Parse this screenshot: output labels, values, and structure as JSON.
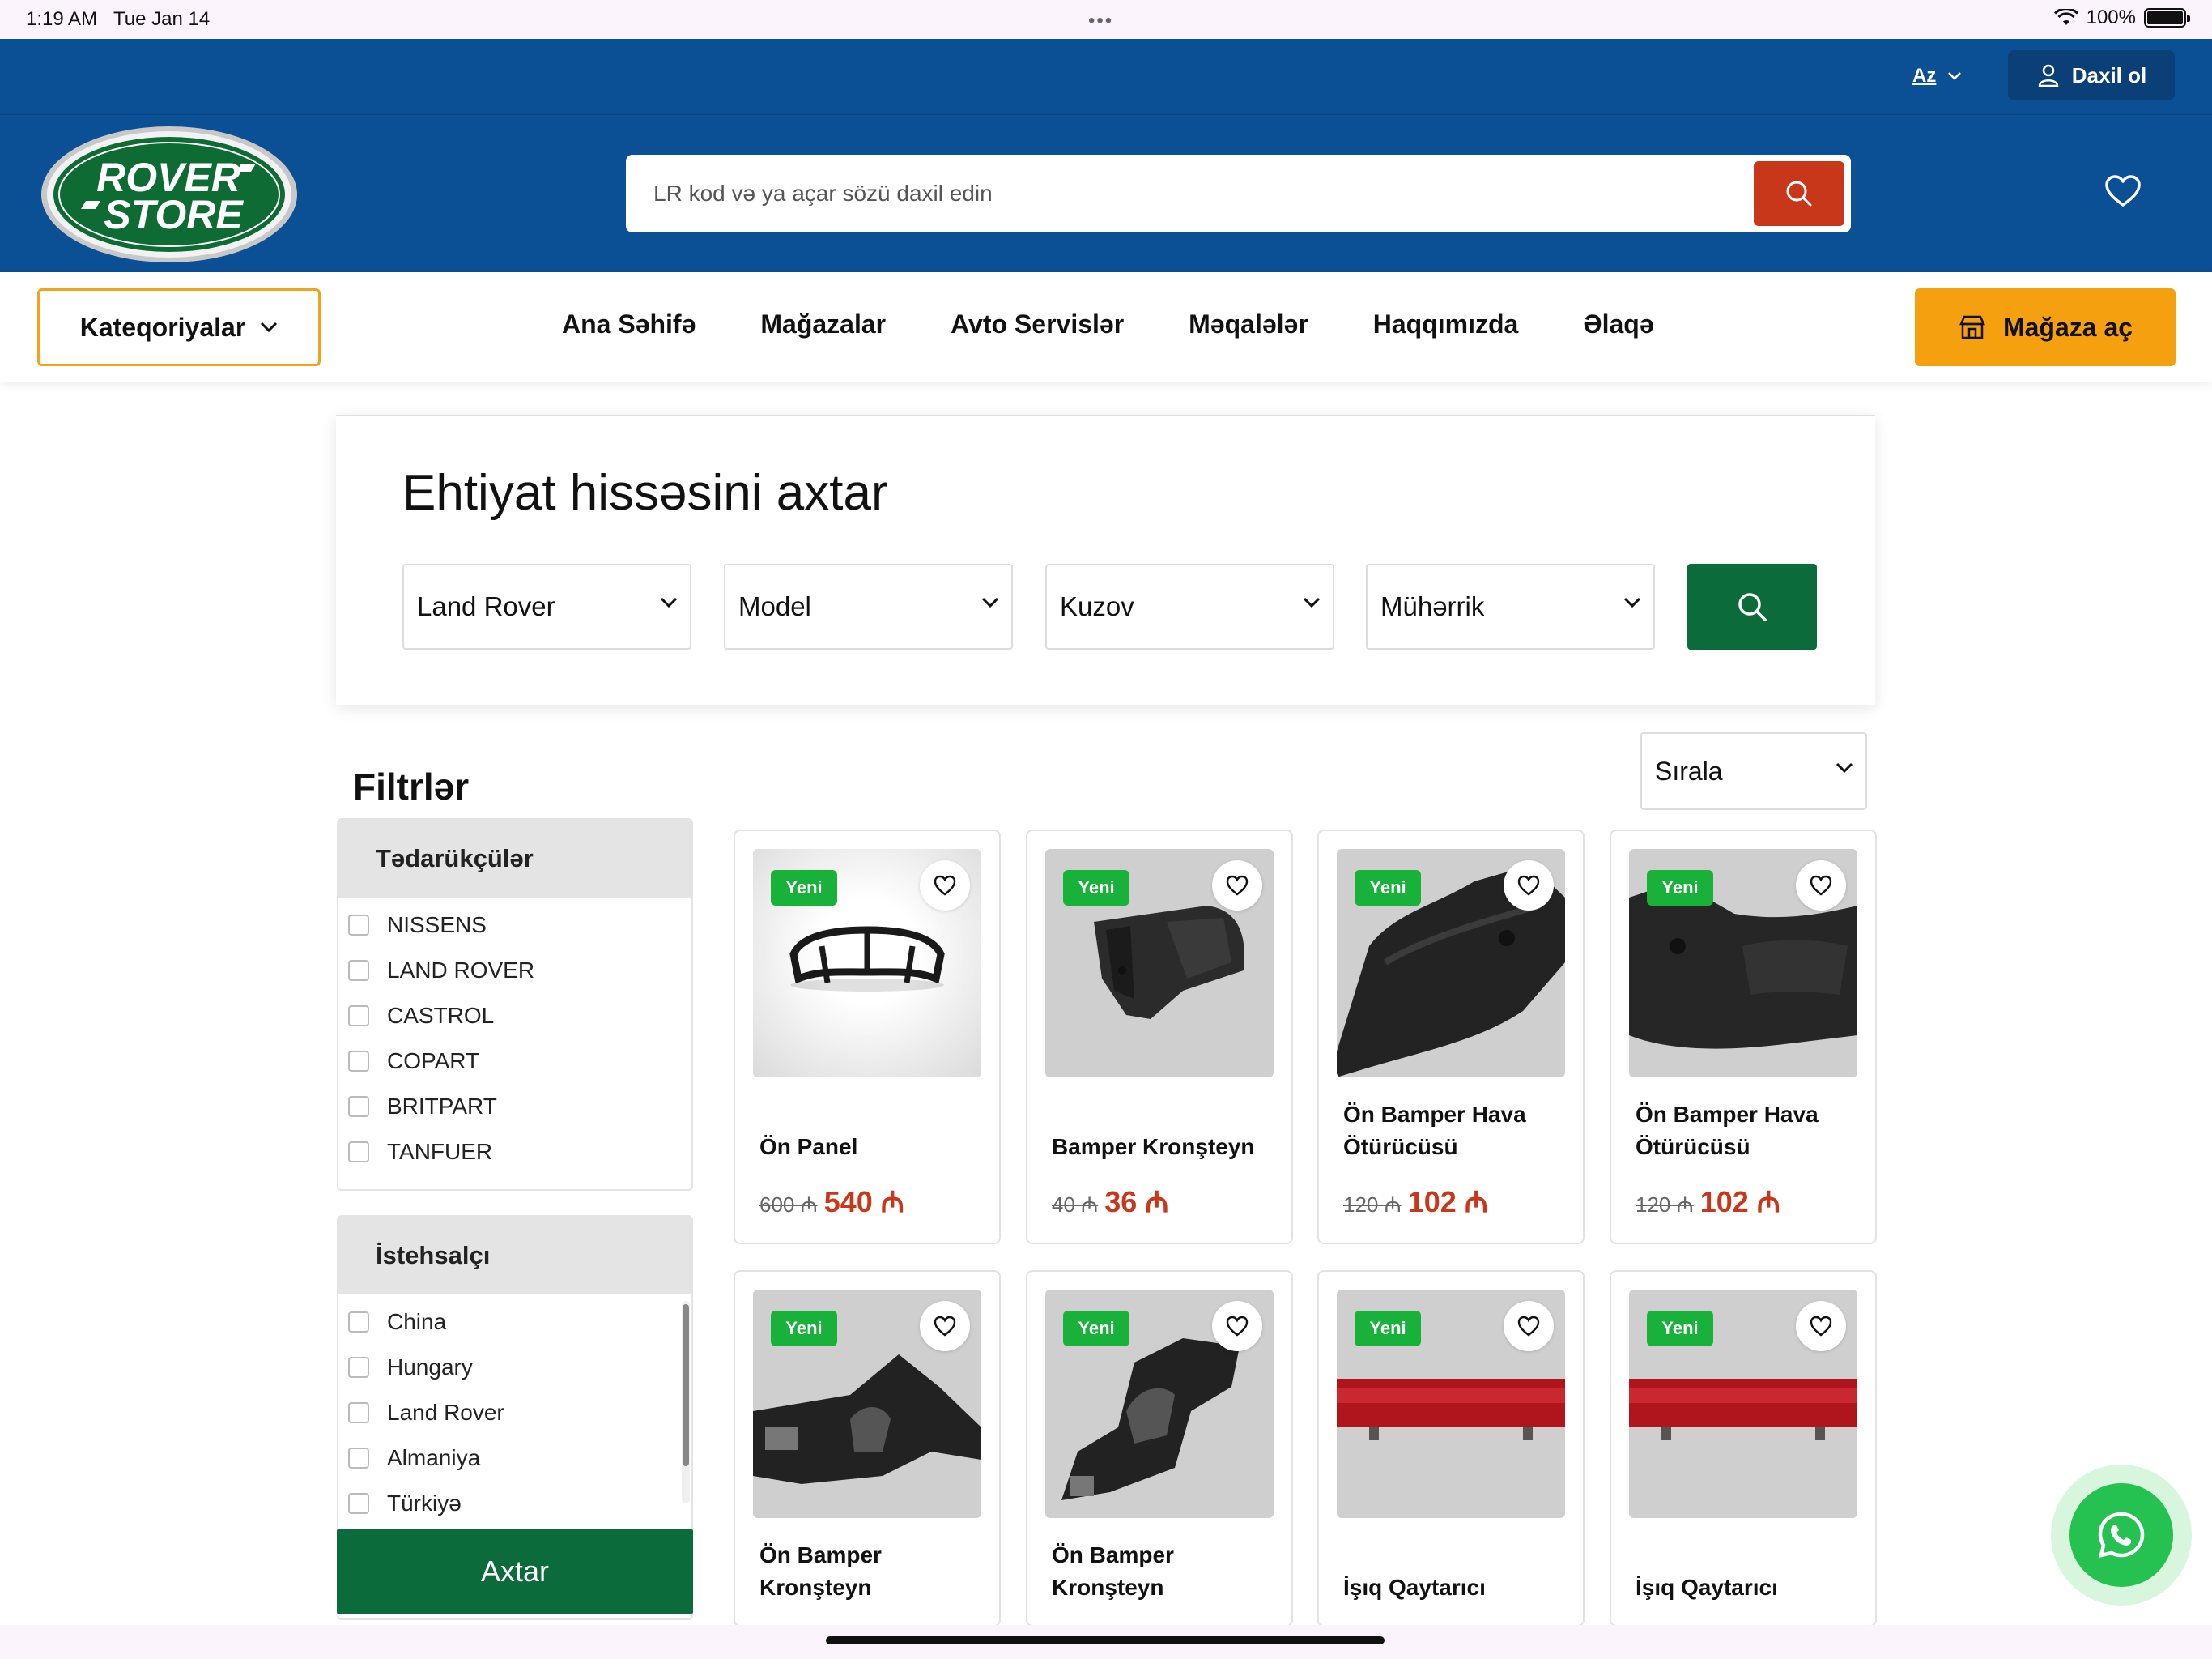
{
  "status": {
    "time": "1:19 AM",
    "date": "Tue Jan 14",
    "dots": "•••",
    "battery": "100%"
  },
  "topbar": {
    "lang": "Az",
    "login": "Daxil ol"
  },
  "header": {
    "logo_line1": "ROVER",
    "logo_line2": "STORE",
    "search_placeholder": "LR kod və ya açar sözü daxil edin"
  },
  "nav": {
    "categories": "Kateqoriyalar",
    "links": [
      "Ana Səhifə",
      "Mağazalar",
      "Avto Servislər",
      "Məqalələr",
      "Haqqımızda",
      "Əlaqə"
    ],
    "open_store": "Mağaza aç"
  },
  "part_search": {
    "title": "Ehtiyat hissəsini axtar",
    "brand": "Land Rover",
    "model": "Model",
    "body": "Kuzov",
    "engine": "Mühərrik"
  },
  "filters": {
    "title": "Filtrlər",
    "suppliers": {
      "title": "Tədarükçülər",
      "items": [
        "NISSENS",
        "LAND ROVER",
        "CASTROL",
        "COPART",
        "BRITPART",
        "TANFUER"
      ]
    },
    "manufacturer": {
      "title": "İstehsalçı",
      "items": [
        "China",
        "Hungary",
        "Land Rover",
        "Almaniya",
        "Türkiyə"
      ]
    },
    "search_button": "Axtar"
  },
  "sort": {
    "label": "Sırala"
  },
  "currency": "₼",
  "products": [
    {
      "badge": "Yeni",
      "name": "Ön Panel",
      "old_price": "600",
      "price": "540"
    },
    {
      "badge": "Yeni",
      "name": "Bamper Kronşteyn",
      "old_price": "40",
      "price": "36"
    },
    {
      "badge": "Yeni",
      "name": "Ön Bamper Hava Ötürücüsü",
      "old_price": "120",
      "price": "102"
    },
    {
      "badge": "Yeni",
      "name": "Ön Bamper Hava Ötürücüsü",
      "old_price": "120",
      "price": "102"
    },
    {
      "badge": "Yeni",
      "name": "Ön Bamper Kronşteyn"
    },
    {
      "badge": "Yeni",
      "name": "Ön Bamper Kronşteyn"
    },
    {
      "badge": "Yeni",
      "name": "İşıq Qaytarıcı"
    },
    {
      "badge": "Yeni",
      "name": "İşıq Qaytarıcı"
    }
  ],
  "colors": {
    "primary_blue": "#0b4f94",
    "accent_orange": "#f5a00e",
    "green": "#0b6b3a",
    "price_red": "#c9371b",
    "badge_green": "#18b23b"
  }
}
